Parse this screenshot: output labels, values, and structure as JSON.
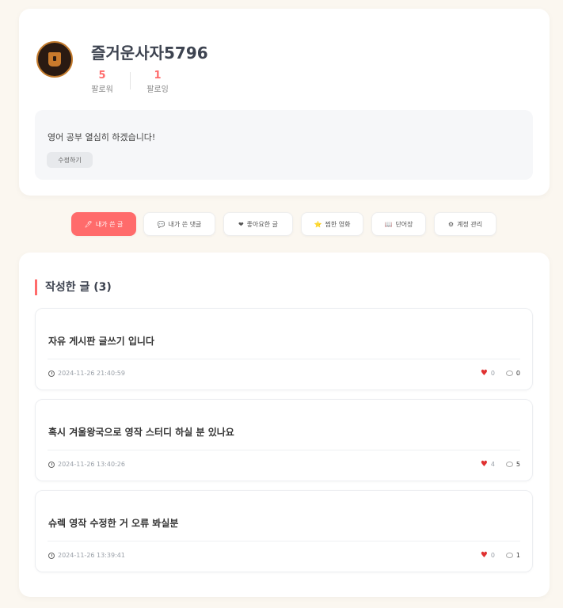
{
  "profile": {
    "username": "즐거운사자5796",
    "followers_count": "5",
    "followers_label": "팔로워",
    "following_count": "1",
    "following_label": "팔로잉",
    "bio": "영어 공부 열심히 하겠습니다!",
    "edit_label": "수정하기"
  },
  "tabs": [
    {
      "icon": "🖊",
      "label": "내가 쓴 글"
    },
    {
      "icon": "💬",
      "label": "내가 쓴 댓글"
    },
    {
      "icon": "❤",
      "label": "좋아요한 글"
    },
    {
      "icon": "⭐",
      "label": "찜한 영화"
    },
    {
      "icon": "📖",
      "label": "단어장"
    },
    {
      "icon": "⚙",
      "label": "계정 관리"
    }
  ],
  "section": {
    "title": "작성한 글",
    "count": "(3)"
  },
  "posts": [
    {
      "title": "자유 게시판 글쓰기 입니다",
      "date": "2024-11-26 21:40:59",
      "likes": "0",
      "comments": "0"
    },
    {
      "title": "혹시 겨울왕국으로 영작 스터디 하실 분 있나요",
      "date": "2024-11-26 13:40:26",
      "likes": "4",
      "comments": "5"
    },
    {
      "title": "슈렉 영작 수정한 거 오류 봐실분",
      "date": "2024-11-26 13:39:41",
      "likes": "0",
      "comments": "1"
    }
  ],
  "colors": {
    "accent": "#ff6b6b",
    "background": "#fbf7f0",
    "heart": "#e03131"
  }
}
